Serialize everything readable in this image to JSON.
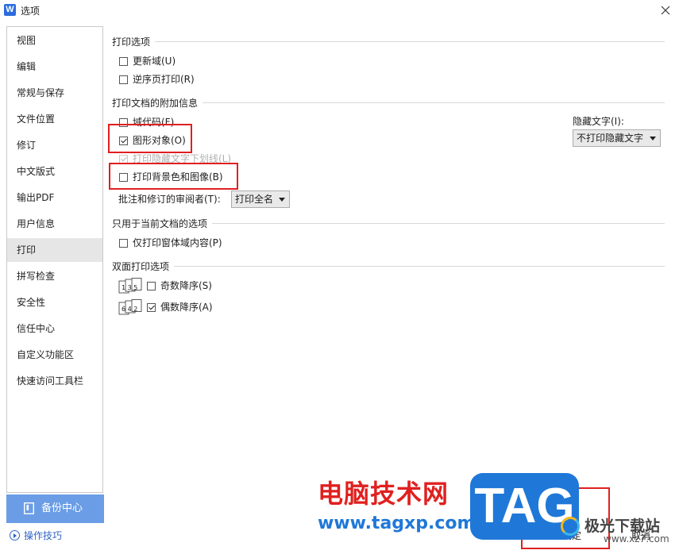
{
  "window": {
    "app_logo": "W",
    "title": "选项"
  },
  "sidebar": {
    "items": [
      {
        "label": "视图"
      },
      {
        "label": "编辑"
      },
      {
        "label": "常规与保存"
      },
      {
        "label": "文件位置"
      },
      {
        "label": "修订"
      },
      {
        "label": "中文版式"
      },
      {
        "label": "输出PDF"
      },
      {
        "label": "用户信息"
      },
      {
        "label": "打印"
      },
      {
        "label": "拼写检查"
      },
      {
        "label": "安全性"
      },
      {
        "label": "信任中心"
      },
      {
        "label": "自定义功能区"
      },
      {
        "label": "快速访问工具栏"
      }
    ],
    "active": "打印",
    "backup_label": "备份中心",
    "tips_label": "操作技巧"
  },
  "print": {
    "sec_print_options": "打印选项",
    "update_fields": "更新域(U)",
    "reverse_order": "逆序页打印(R)",
    "sec_additional_info": "打印文档的附加信息",
    "field_codes": "域代码(F)",
    "drawing_objects": "图形对象(O)",
    "hidden_text_underline": "打印隐藏文字下划线(L)",
    "background": "打印背景色和图像(B)",
    "hidden_text_label": "隐藏文字(I):",
    "hidden_text_value": "不打印隐藏文字",
    "reviewer_label": "批注和修订的审阅者(T):",
    "reviewer_value": "打印全名",
    "sec_current_doc": "只用于当前文档的选项",
    "form_data_only": "仅打印窗体域内容(P)",
    "sec_duplex": "双面打印选项",
    "duplex_odd_icon": "1 3 5",
    "odd_pages": "奇数降序(S)",
    "duplex_even_icon": "6 4 2",
    "even_pages": "偶数降序(A)"
  },
  "states": {
    "update_fields": false,
    "reverse_order": false,
    "field_codes": false,
    "drawing_objects": true,
    "hidden_text_underline": true,
    "background": false,
    "form_data_only": false,
    "odd_pages": false,
    "even_pages": true
  },
  "footer": {
    "ok_label": "确定",
    "cancel_label": "取消"
  },
  "watermark": {
    "site_name": "电脑技术网",
    "site_url": "www.tagxp.com",
    "tag_logo": "TAG",
    "site2_name": "极光下载站",
    "site2_url": "www.xz7.com"
  },
  "colors": {
    "accent": "#6a9de6",
    "highlight_box": "#e02020",
    "tag_blue": "#1f78d8",
    "link": "#2f64c4"
  }
}
